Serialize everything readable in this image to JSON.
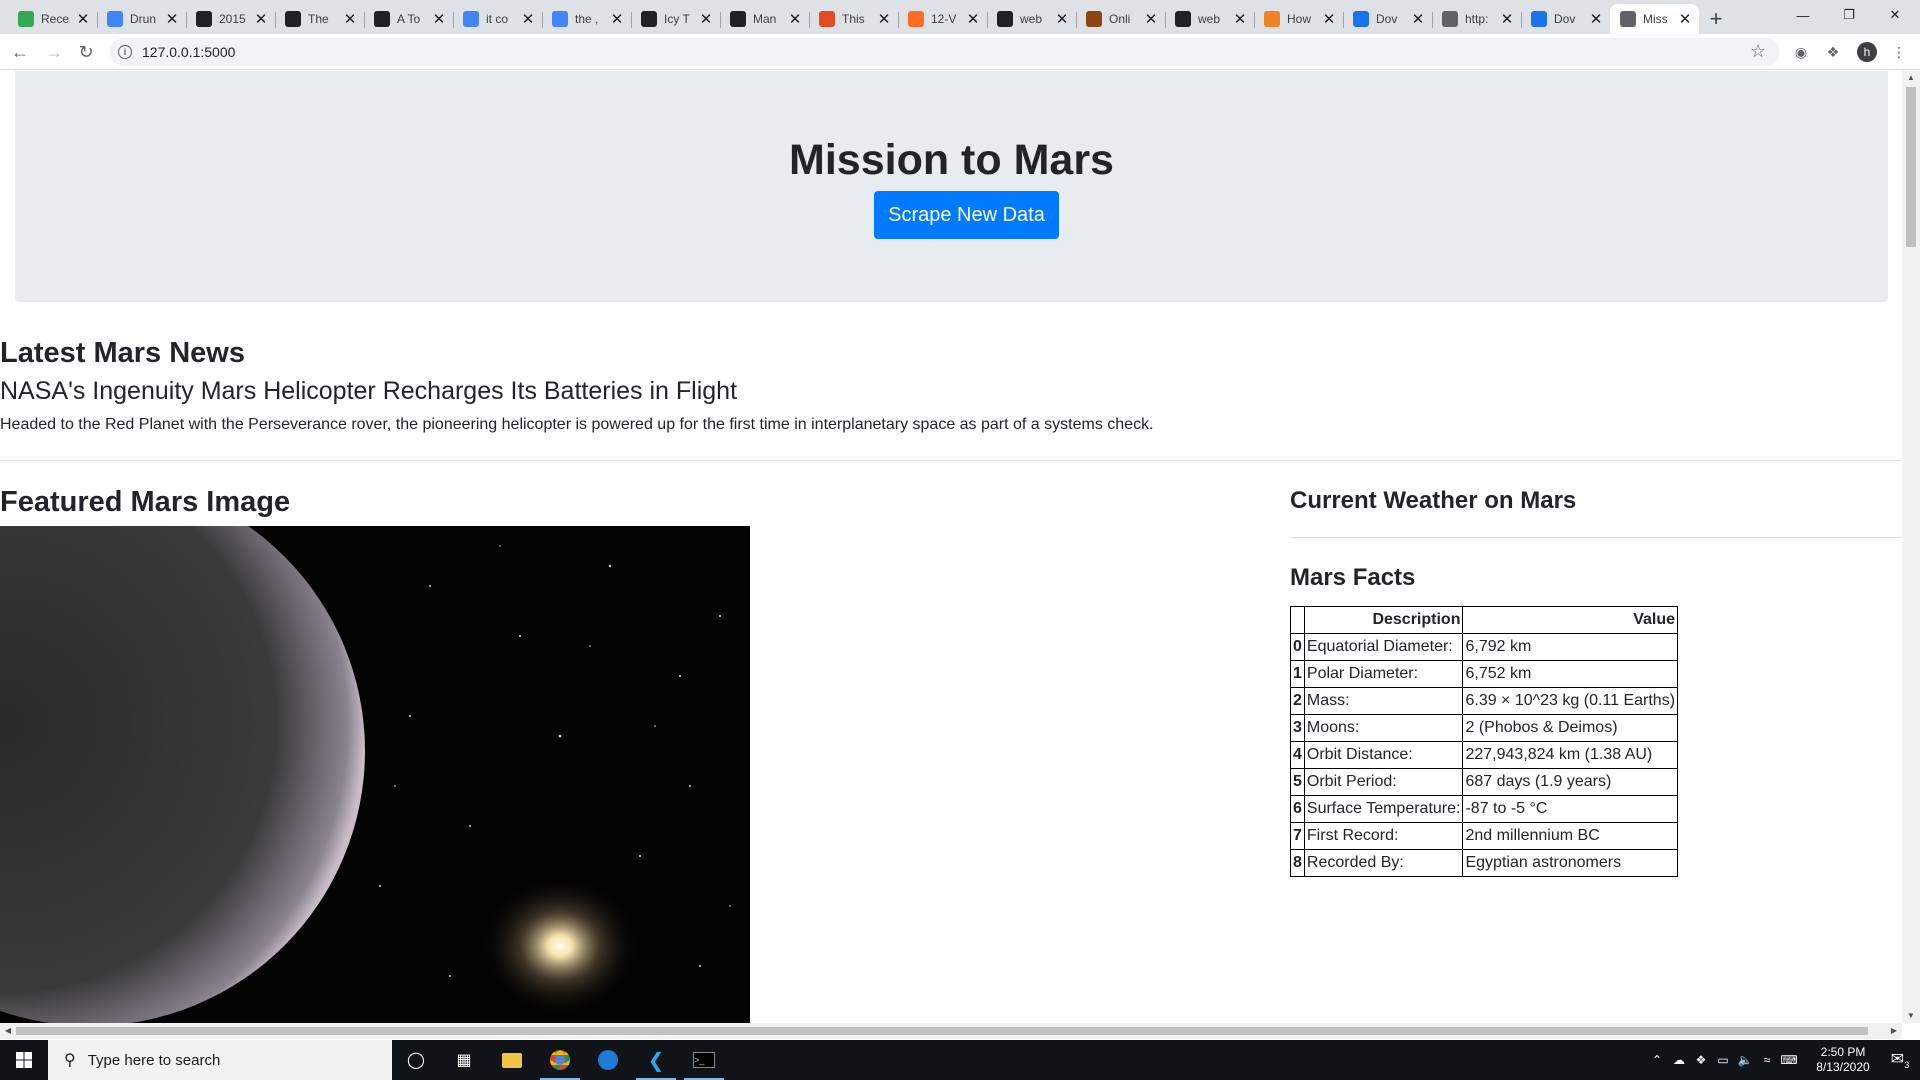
{
  "browser": {
    "tabs": [
      {
        "label": "Rece",
        "favicon": "drive-icon",
        "color": "#34a853"
      },
      {
        "label": "Drun",
        "favicon": "docs-icon",
        "color": "#4285f4"
      },
      {
        "label": "2015",
        "favicon": "sheet-icon",
        "color": "#202124"
      },
      {
        "label": "The",
        "favicon": "d-icon",
        "color": "#202124"
      },
      {
        "label": "A To",
        "favicon": "a-icon",
        "color": "#202124"
      },
      {
        "label": "it co",
        "favicon": "google-icon",
        "color": "#4285f4"
      },
      {
        "label": "the ,",
        "favicon": "google-icon",
        "color": "#4285f4"
      },
      {
        "label": "Icy T",
        "favicon": "circle-icon",
        "color": "#202124"
      },
      {
        "label": "Man",
        "favicon": "c-icon",
        "color": "#202124"
      },
      {
        "label": "This",
        "favicon": "reddit-icon",
        "color": "#e34c26"
      },
      {
        "label": "12-V",
        "favicon": "gitlab-icon",
        "color": "#fc6d26"
      },
      {
        "label": "web",
        "favicon": "github-icon",
        "color": "#202124"
      },
      {
        "label": "Onli",
        "favicon": "hand-icon",
        "color": "#8b4513"
      },
      {
        "label": "web",
        "favicon": "github-icon",
        "color": "#202124"
      },
      {
        "label": "How",
        "favicon": "stack-icon",
        "color": "#f48024"
      },
      {
        "label": "Dov",
        "favicon": "doc-icon",
        "color": "#1a73e8"
      },
      {
        "label": "http:",
        "favicon": "globe-icon",
        "color": "#5f6368"
      },
      {
        "label": "Dov",
        "favicon": "doc-icon",
        "color": "#1a73e8"
      },
      {
        "label": "Miss",
        "favicon": "globe-icon",
        "color": "#5f6368",
        "active": true
      }
    ],
    "url": "127.0.0.1:5000",
    "profile_initial": "h"
  },
  "page": {
    "title": "Mission to Mars",
    "scrape_button": "Scrape New Data",
    "news_heading": "Latest Mars News",
    "news_title": "NASA's Ingenuity Mars Helicopter Recharges Its Batteries in Flight",
    "news_paragraph": "Headed to the Red Planet with the Perseverance rover, the pioneering helicopter is powered up for the first time in interplanetary space as part of a systems check.",
    "featured_heading": "Featured Mars Image",
    "weather_heading": "Current Weather on Mars",
    "facts_heading": "Mars Facts",
    "facts": {
      "headers": [
        "",
        "Description",
        "Value"
      ],
      "rows": [
        {
          "index": "0",
          "description": "Equatorial Diameter:",
          "value": "6,792 km"
        },
        {
          "index": "1",
          "description": "Polar Diameter:",
          "value": "6,752 km"
        },
        {
          "index": "2",
          "description": "Mass:",
          "value": "6.39 × 10^23 kg (0.11 Earths)"
        },
        {
          "index": "3",
          "description": "Moons:",
          "value": "2 (Phobos & Deimos)"
        },
        {
          "index": "4",
          "description": "Orbit Distance:",
          "value": "227,943,824 km (1.38 AU)"
        },
        {
          "index": "5",
          "description": "Orbit Period:",
          "value": "687 days (1.9 years)"
        },
        {
          "index": "6",
          "description": "Surface Temperature:",
          "value": "-87 to -5 °C"
        },
        {
          "index": "7",
          "description": "First Record:",
          "value": "2nd millennium BC"
        },
        {
          "index": "8",
          "description": "Recorded By:",
          "value": "Egyptian astronomers"
        }
      ]
    }
  },
  "taskbar": {
    "search_placeholder": "Type here to search",
    "time": "2:50 PM",
    "date": "8/13/2020",
    "notification_count": "3"
  }
}
